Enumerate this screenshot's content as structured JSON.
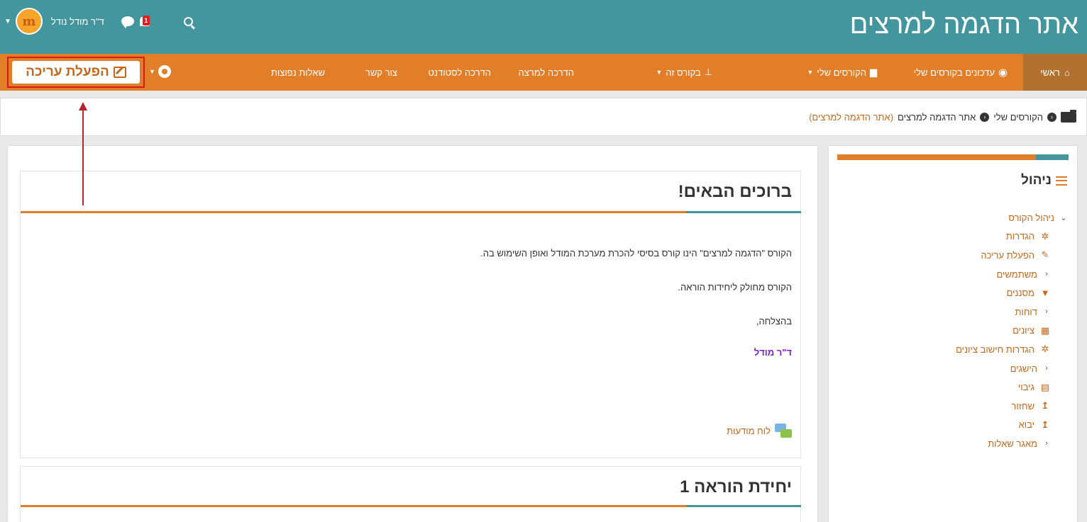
{
  "header": {
    "site_title": "אתר הדגמה למרצים",
    "user_name": "ד\"ר מודל נודל",
    "avatar_letters": "m",
    "notification_count": "1"
  },
  "nav": {
    "home": "ראשי",
    "updates": "עדכונים בקורסים שלי",
    "my_courses": "הקורסים שלי",
    "this_course": "בקורס זה",
    "lecturer_guide": "הדרכה למרצה",
    "student_guide": "הדרכה לסטודנט",
    "contact": "צור קשר",
    "faq": "שאלות נפוצות",
    "edit_button": "הפעלת עריכה"
  },
  "breadcrumb": {
    "my_courses": "הקורסים שלי",
    "site": "אתר הדגמה למרצים",
    "site_paren": "(אתר הדגמה למרצים)"
  },
  "admin": {
    "title": "ניהול",
    "items": [
      {
        "label": "ניהול הקורס",
        "icon": "chevron-down"
      },
      {
        "label": "הגדרות",
        "icon": "gear"
      },
      {
        "label": "הפעלת עריכה",
        "icon": "pencil"
      },
      {
        "label": "משתמשים",
        "icon": "chevron-left"
      },
      {
        "label": "מסננים",
        "icon": "filter"
      },
      {
        "label": "דוחות",
        "icon": "chevron-left"
      },
      {
        "label": "ציונים",
        "icon": "table"
      },
      {
        "label": "הגדרות חישוב ציונים",
        "icon": "gear"
      },
      {
        "label": "הישגים",
        "icon": "chevron-left"
      },
      {
        "label": "גיבוי",
        "icon": "file"
      },
      {
        "label": "שחזור",
        "icon": "upload"
      },
      {
        "label": "יבוא",
        "icon": "upload"
      },
      {
        "label": "מאגר שאלות",
        "icon": "chevron-left"
      }
    ]
  },
  "main": {
    "welcome_title": "ברוכים הבאים!",
    "para1": "הקורס \"הדגמה למרצים\" הינו קורס בסיסי להכרת מערכת המודל ואופן השימוש בה.",
    "para2": "הקורס מחולק ליחידות הוראה.",
    "para3": "בהצלחה,",
    "signature": "ד\"ר מודל",
    "forum_link": "לוח מודעות",
    "unit1_title": "יחידת הוראה 1"
  },
  "colors": {
    "header_teal": "#43959e",
    "nav_orange": "#e27d28",
    "home_brown": "#b2712e",
    "link_orange": "#c16a1f",
    "signature_purple": "#7a1fd6",
    "annotation_red": "#d81c1c"
  }
}
